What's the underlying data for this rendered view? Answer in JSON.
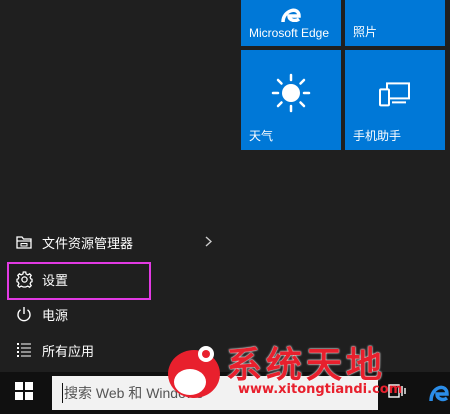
{
  "tiles": {
    "edge": {
      "label": "Microsoft Edge",
      "icon": "edge-logo-icon"
    },
    "photos": {
      "label": "照片"
    },
    "weather": {
      "label": "天气",
      "icon": "sun-icon"
    },
    "phone": {
      "label": "手机助手",
      "icon": "phone-companion-icon"
    }
  },
  "menu": {
    "explorer": {
      "label": "文件资源管理器",
      "icon": "folder-icon"
    },
    "settings": {
      "label": "设置",
      "icon": "gear-icon"
    },
    "power": {
      "label": "电源",
      "icon": "power-icon"
    },
    "all_apps": {
      "label": "所有应用",
      "icon": "list-icon"
    }
  },
  "taskbar": {
    "search_text": "搜索 Web 和 Windows"
  },
  "watermark": {
    "title": "系统天地",
    "url": "www.xitongtiandi.com"
  },
  "colors": {
    "tile_blue": "#0078d7",
    "highlight": "#e23ae3",
    "watermark_red": "#e8202d"
  }
}
